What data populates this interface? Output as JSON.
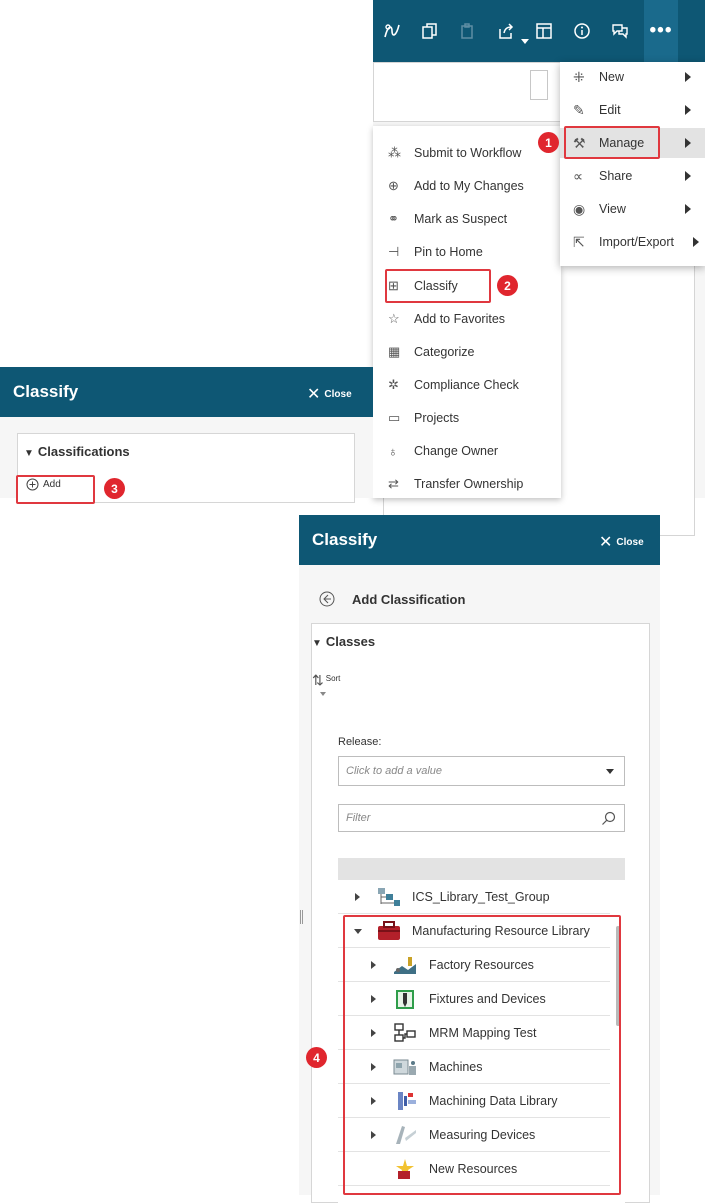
{
  "toolbar": {
    "icons": [
      "workflow-icon",
      "copy-icon",
      "paste-icon",
      "share-export-icon",
      "table-icon",
      "info-icon",
      "chat-icon",
      "more-icon"
    ],
    "more_label": "•••"
  },
  "main_menu": {
    "items": [
      {
        "label": "New",
        "icon": "sparkle-icon"
      },
      {
        "label": "Edit",
        "icon": "pencil-icon"
      },
      {
        "label": "Manage",
        "icon": "tools-icon"
      },
      {
        "label": "Share",
        "icon": "share-icon"
      },
      {
        "label": "View",
        "icon": "eye-icon"
      },
      {
        "label": "Import/Export",
        "icon": "import-export-icon"
      }
    ]
  },
  "manage_menu": {
    "items": [
      {
        "label": "Submit to Workflow",
        "icon": "workflow-icon"
      },
      {
        "label": "Add to My Changes",
        "icon": "add-changes-icon"
      },
      {
        "label": "Mark as Suspect",
        "icon": "suspect-icon"
      },
      {
        "label": "Pin to Home",
        "icon": "pin-icon"
      },
      {
        "label": "Classify",
        "icon": "classify-icon"
      },
      {
        "label": "Add to Favorites",
        "icon": "star-icon"
      },
      {
        "label": "Categorize",
        "icon": "categorize-icon"
      },
      {
        "label": "Compliance Check",
        "icon": "compliance-icon"
      },
      {
        "label": "Projects",
        "icon": "projects-icon"
      },
      {
        "label": "Change Owner",
        "icon": "change-owner-icon"
      },
      {
        "label": "Transfer Ownership",
        "icon": "transfer-icon"
      }
    ]
  },
  "callouts": [
    "1",
    "2",
    "3",
    "4"
  ],
  "classify_panel": {
    "title": "Classify",
    "close_label": "Close",
    "section_title": "Classifications",
    "add_label": "Add"
  },
  "add_classification": {
    "title": "Classify",
    "close_label": "Close",
    "subtitle": "Add Classification",
    "section_title": "Classes",
    "sort_label": "Sort",
    "release_label": "Release:",
    "release_placeholder": "Click to add a value",
    "filter_placeholder": "Filter",
    "tree": [
      {
        "label": "ICS_Library_Test_Group",
        "level": 0,
        "expander": "collapsed",
        "icon": "group-class-icon"
      },
      {
        "label": "Manufacturing Resource Library",
        "level": 0,
        "expander": "expanded",
        "icon": "toolbox-icon"
      },
      {
        "label": "Factory Resources",
        "level": 1,
        "expander": "collapsed",
        "icon": "factory-icon"
      },
      {
        "label": "Fixtures and Devices",
        "level": 1,
        "expander": "collapsed",
        "icon": "fixture-icon"
      },
      {
        "label": "MRM Mapping Test",
        "level": 1,
        "expander": "collapsed",
        "icon": "mapping-icon"
      },
      {
        "label": "Machines",
        "level": 1,
        "expander": "collapsed",
        "icon": "machine-icon"
      },
      {
        "label": "Machining Data Library",
        "level": 1,
        "expander": "collapsed",
        "icon": "machining-data-icon"
      },
      {
        "label": "Measuring Devices",
        "level": 1,
        "expander": "collapsed",
        "icon": "measuring-icon"
      },
      {
        "label": "New Resources",
        "level": 1,
        "expander": "none",
        "icon": "new-resource-icon"
      }
    ]
  },
  "colors": {
    "header": "#0e5774",
    "callout": "#e0262e",
    "highlight_border": "#e0383f"
  }
}
